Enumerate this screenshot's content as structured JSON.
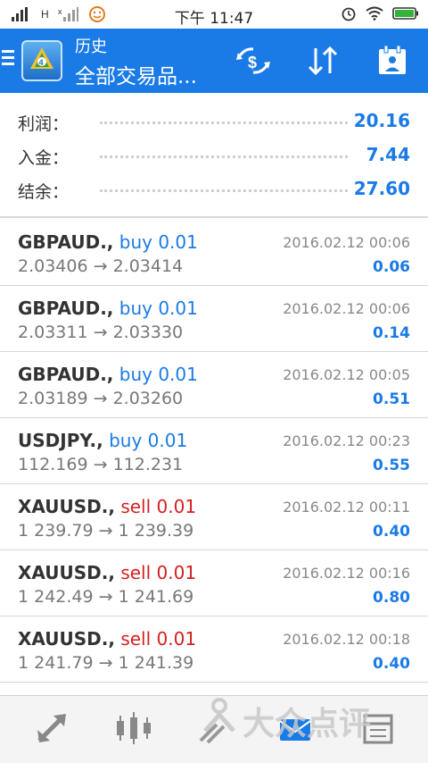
{
  "status_bar": {
    "time": "下午 11:47",
    "signal_label": "H"
  },
  "app_bar": {
    "title_small": "历史",
    "title_big": "全部交易品...",
    "icons": [
      "menu-icon",
      "mt4-logo-icon",
      "currency-exchange-icon",
      "sort-icon",
      "calendar-icon"
    ]
  },
  "summary": {
    "rows": [
      {
        "label": "利润：",
        "value": "20.16"
      },
      {
        "label": "入金：",
        "value": "7.44"
      },
      {
        "label": "结余：",
        "value": "27.60"
      }
    ]
  },
  "trades": [
    {
      "symbol": "GBPAUD.,",
      "type": "buy 0.01",
      "side": "buy",
      "prices": "2.03406 → 2.03414",
      "time": "2016.02.12 00:06",
      "profit": "0.06"
    },
    {
      "symbol": "GBPAUD.,",
      "type": "buy 0.01",
      "side": "buy",
      "prices": "2.03311 → 2.03330",
      "time": "2016.02.12 00:06",
      "profit": "0.14"
    },
    {
      "symbol": "GBPAUD.,",
      "type": "buy 0.01",
      "side": "buy",
      "prices": "2.03189 → 2.03260",
      "time": "2016.02.12 00:05",
      "profit": "0.51"
    },
    {
      "symbol": "USDJPY.,",
      "type": "buy 0.01",
      "side": "buy",
      "prices": "112.169 → 112.231",
      "time": "2016.02.12 00:23",
      "profit": "0.55"
    },
    {
      "symbol": "XAUUSD.,",
      "type": "sell 0.01",
      "side": "sell",
      "prices": "1 239.79 → 1 239.39",
      "time": "2016.02.12 00:11",
      "profit": "0.40"
    },
    {
      "symbol": "XAUUSD.,",
      "type": "sell 0.01",
      "side": "sell",
      "prices": "1 242.49 → 1 241.69",
      "time": "2016.02.12 00:16",
      "profit": "0.80"
    },
    {
      "symbol": "XAUUSD.,",
      "type": "sell 0.01",
      "side": "sell",
      "prices": "1 241.79 → 1 241.39",
      "time": "2016.02.12 00:18",
      "profit": "0.40"
    }
  ],
  "bottom_nav": {
    "items": [
      "quotes-icon",
      "chart-icon",
      "trade-icon",
      "history-icon",
      "news-icon"
    ]
  },
  "watermark": "大众点评",
  "colors": {
    "accent": "#1a7be6",
    "sell": "#d42020",
    "nav_bg": "#f4f4f4"
  }
}
